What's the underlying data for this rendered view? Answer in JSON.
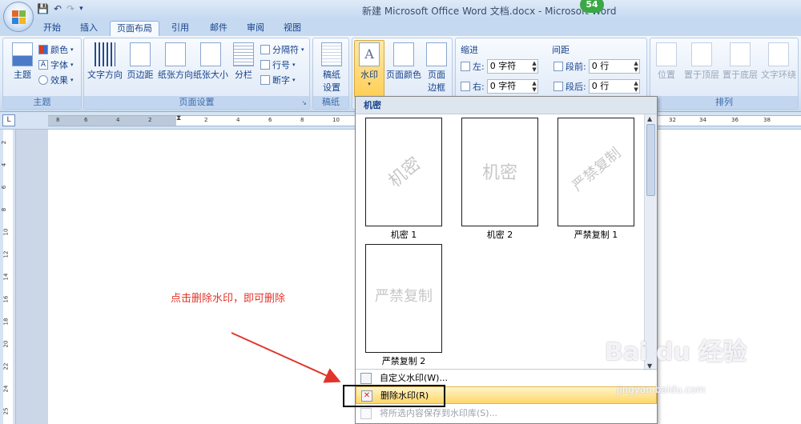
{
  "window": {
    "title": "新建 Microsoft Office Word 文档.docx - Microsoft Word",
    "badge": "54"
  },
  "tabs": [
    {
      "label": "开始"
    },
    {
      "label": "插入"
    },
    {
      "label": "页面布局",
      "active": true
    },
    {
      "label": "引用"
    },
    {
      "label": "邮件"
    },
    {
      "label": "审阅"
    },
    {
      "label": "视图"
    }
  ],
  "ribbon": {
    "theme_group": {
      "label": "主题",
      "theme_btn": "主题",
      "colors": "颜色",
      "fonts": "字体",
      "effects": "效果"
    },
    "page_setup_group": {
      "label": "页面设置",
      "text_direction": "文字方向",
      "margins": "页边距",
      "orientation": "纸张方向",
      "size": "纸张大小",
      "columns": "分栏",
      "breaks": "分隔符",
      "line_numbers": "行号",
      "hyphenation": "断字"
    },
    "draft_group": {
      "label": "稿纸",
      "draft_btn_line1": "稿纸",
      "draft_btn_line2": "设置"
    },
    "background_group": {
      "watermark": "水印",
      "page_color": "页面颜色",
      "page_border_line1": "页面",
      "page_border_line2": "边框"
    },
    "paragraph_group": {
      "indent_label": "缩进",
      "spacing_label": "间距",
      "left_label": "左:",
      "left_value": "0 字符",
      "right_label": "右:",
      "right_value": "0 字符",
      "before_label": "段前:",
      "before_value": "0 行",
      "after_label": "段后:",
      "after_value": "0 行"
    },
    "arrange_group": {
      "label": "排列",
      "position": "位置",
      "bring_front": "置于顶层",
      "send_back": "置于底层",
      "text_wrap": "文字环绕"
    }
  },
  "ruler": {
    "labels": [
      "8",
      "6",
      "4",
      "2",
      "2",
      "4",
      "6",
      "8",
      "10",
      "32",
      "34",
      "36",
      "38"
    ],
    "vertical_labels": [
      "2",
      "4",
      "6",
      "8",
      "10",
      "12",
      "14",
      "16",
      "18",
      "20",
      "22",
      "24",
      "25"
    ]
  },
  "annotation": {
    "text": "点击删除水印，即可删除"
  },
  "watermark_menu": {
    "section_header": "机密",
    "items": [
      {
        "preview": "机密",
        "caption": "机密 1"
      },
      {
        "preview": "机密",
        "caption": "机密 2"
      },
      {
        "preview": "严禁复制",
        "caption": "严禁复制 1"
      },
      {
        "preview": "严禁复制",
        "caption": "严禁复制 2"
      }
    ],
    "custom": "自定义水印(W)...",
    "remove": "删除水印(R)",
    "save_selection": "将所选内容保存到水印库(S)..."
  },
  "site_watermark": {
    "brand": "Bai du 经验",
    "url": "jingyan.baidu.com"
  }
}
